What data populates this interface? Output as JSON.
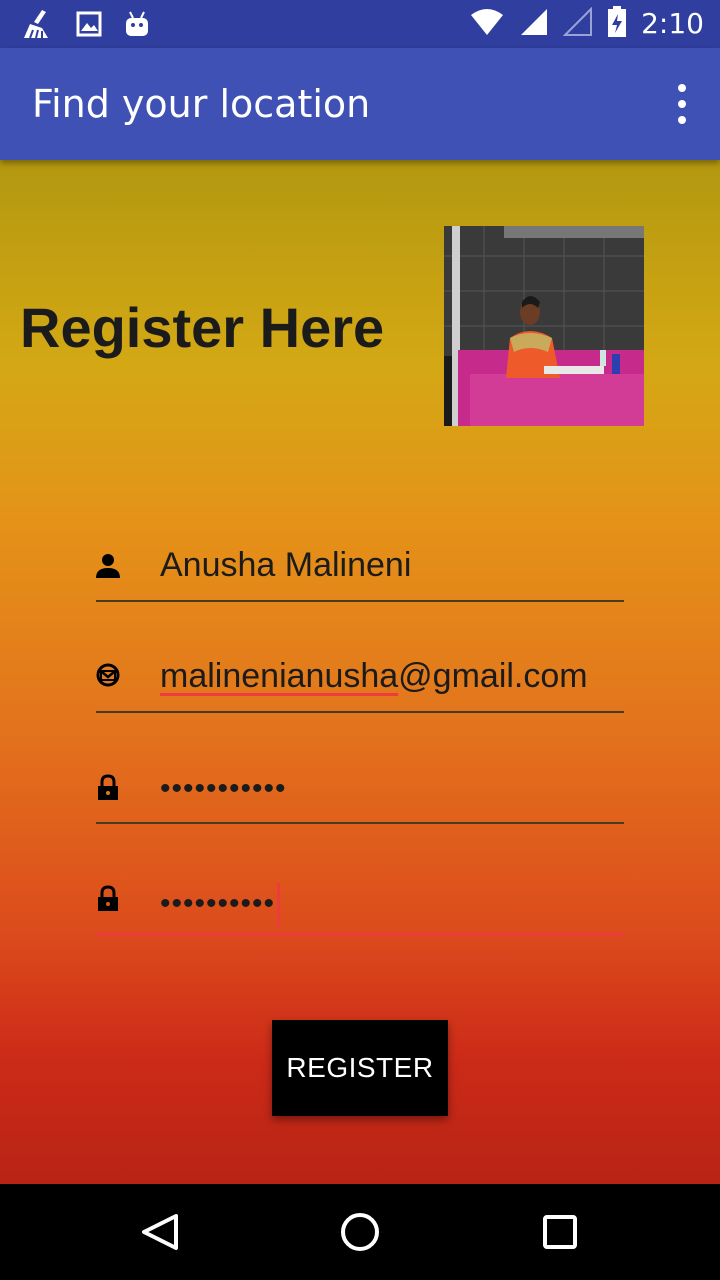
{
  "status_bar": {
    "time": "2:10",
    "icons": [
      "broom-icon",
      "image-icon",
      "android-icon",
      "wifi-icon",
      "signal-icon",
      "signal-empty-icon",
      "battery-charging-icon"
    ]
  },
  "app_bar": {
    "title": "Find your location",
    "menu_icon": "overflow-menu-icon"
  },
  "form": {
    "heading": "Register Here",
    "fields": [
      {
        "icon": "person-icon",
        "value": "Anusha Malineni"
      },
      {
        "icon": "email-icon",
        "value_misspelled": "malinenianusha",
        "value_rest": "@gmail.com"
      },
      {
        "icon": "lock-icon",
        "value": "•••••••••••"
      },
      {
        "icon": "lock-icon",
        "value": "••••••••••"
      }
    ],
    "register_label": "REGISTER"
  },
  "colors": {
    "status_bar": "#303F9F",
    "app_bar": "#3F51B5",
    "accent_error": "#ee3b3b"
  }
}
